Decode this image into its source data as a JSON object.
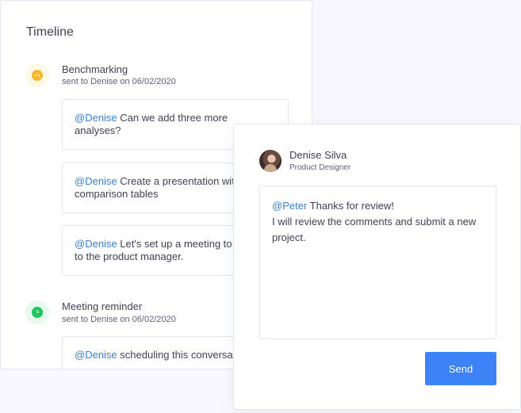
{
  "timeline": {
    "title": "Timeline",
    "events": [
      {
        "title": "Benchmarking",
        "meta": "sent to Denise on 06/02/2020",
        "icon": "chat-bubble-icon",
        "icon_color": "#f5b82e",
        "icon_bg": "#fff8e6",
        "messages": [
          {
            "mention": "@Denise",
            "text": " Can we add three more analyses?"
          },
          {
            "mention": "@Denise",
            "text": " Create a presentation with comparison tables"
          },
          {
            "mention": "@Denise",
            "text": " Let's set up a meeting to present to the product manager."
          }
        ]
      },
      {
        "title": "Meeting reminder",
        "meta": "sent to Denise on 06/02/2020",
        "icon": "clock-icon",
        "icon_color": "#22c55e",
        "icon_bg": "#e8f9ee",
        "messages": [
          {
            "mention": "@Denise",
            "text": " scheduling this conversation"
          }
        ]
      }
    ]
  },
  "reply": {
    "user_name": "Denise Silva",
    "user_role": "Product Designer",
    "mention": "@Peter",
    "line1_rest": " Thanks for review!",
    "line2": "I will review the comments and submit a new project.",
    "send_label": "Send"
  },
  "colors": {
    "accent": "#3e82f7",
    "mention": "#3b82d6"
  }
}
